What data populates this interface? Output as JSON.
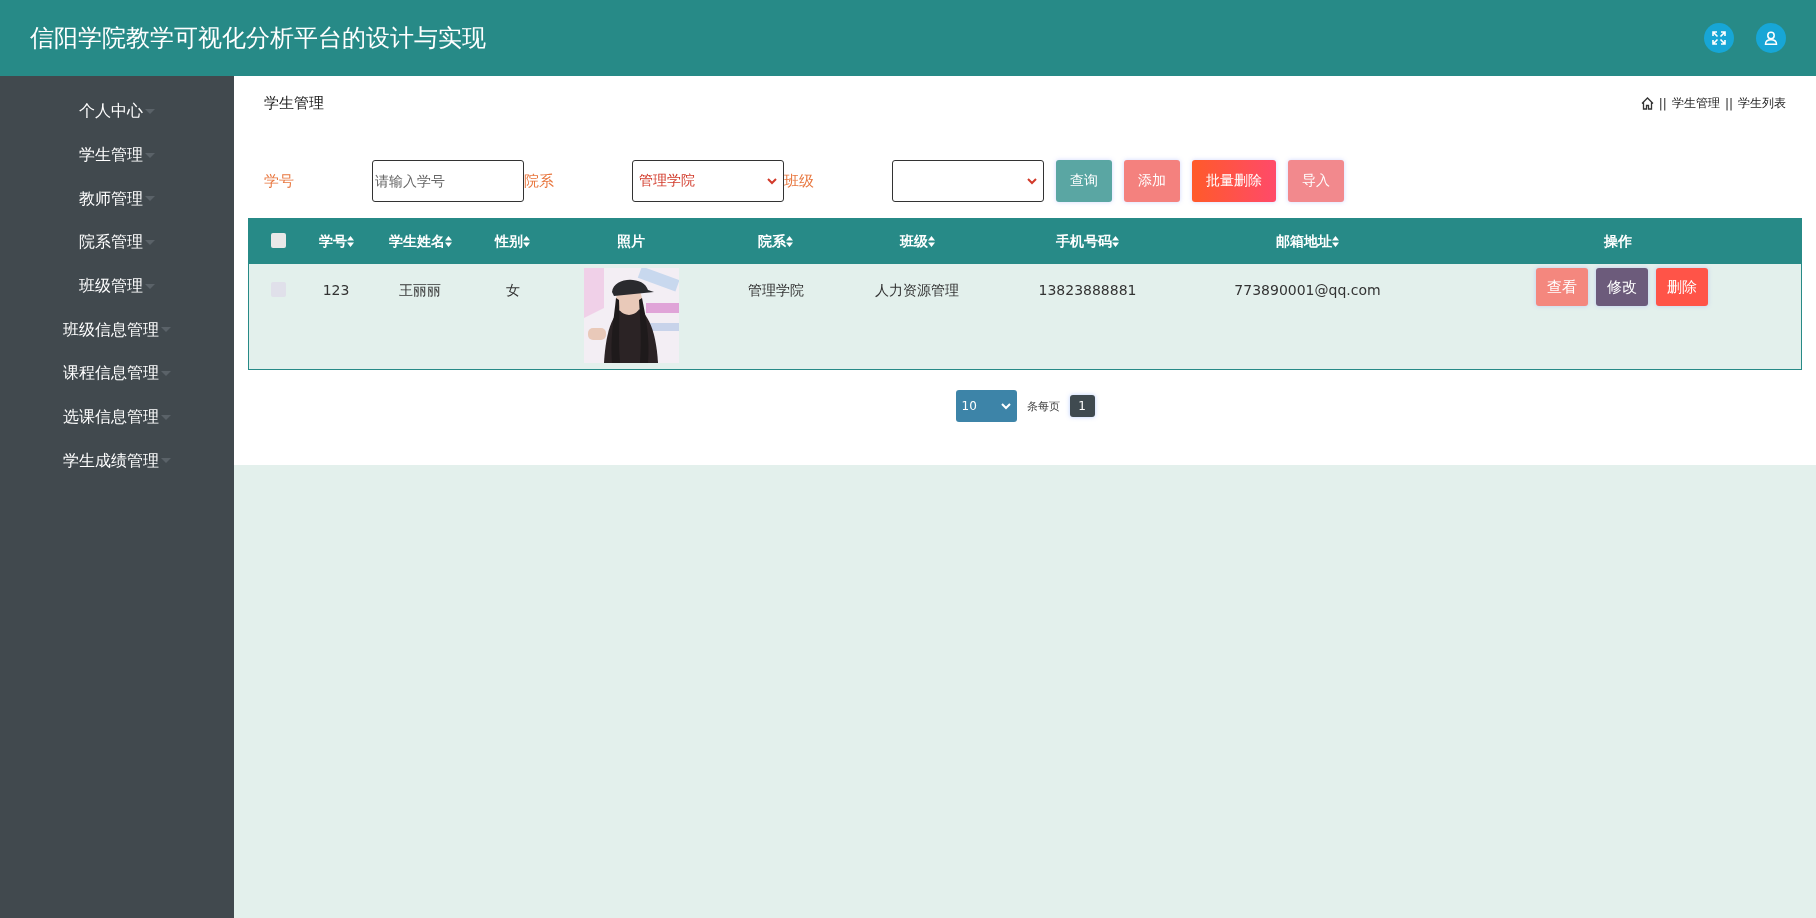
{
  "header": {
    "title": "信阳学院教学可视化分析平台的设计与实现"
  },
  "sidebar": {
    "items": [
      {
        "label": "个人中心"
      },
      {
        "label": "学生管理"
      },
      {
        "label": "教师管理"
      },
      {
        "label": "院系管理"
      },
      {
        "label": "班级管理"
      },
      {
        "label": "班级信息管理"
      },
      {
        "label": "课程信息管理"
      },
      {
        "label": "选课信息管理"
      },
      {
        "label": "学生成绩管理"
      }
    ]
  },
  "page_title": "学生管理",
  "breadcrumb": [
    {
      "separator": "||",
      "label": "学生管理"
    },
    {
      "separator": "||",
      "label": "学生列表"
    }
  ],
  "filters": [
    {
      "kind": "input",
      "label": "学号",
      "placeholder": "请输入学号"
    },
    {
      "kind": "select",
      "label": "院系",
      "value": "管理学院"
    },
    {
      "kind": "select",
      "label": "班级"
    }
  ],
  "actions": [
    {
      "kind": "search",
      "label": "查询"
    },
    {
      "kind": "add",
      "label": "添加"
    },
    {
      "kind": "bulk-delete",
      "label": "批量删除"
    },
    {
      "kind": "import",
      "label": "导入"
    }
  ],
  "table": {
    "all_checked": false,
    "columns": [
      {
        "label": "学号",
        "sortable": true
      },
      {
        "label": "学生姓名",
        "sortable": true
      },
      {
        "label": "性别",
        "sortable": true
      },
      {
        "label": "照片",
        "sortable": false
      },
      {
        "label": "院系",
        "sortable": true
      },
      {
        "label": "班级",
        "sortable": true
      },
      {
        "label": "手机号码",
        "sortable": true
      },
      {
        "label": "邮箱地址",
        "sortable": true
      },
      {
        "label": "操作",
        "sortable": false
      }
    ],
    "rows": [
      {
        "checked": false,
        "cells": [
          "123",
          "王丽丽",
          "女",
          {
            "kind": "picture"
          },
          "管理学院",
          "人力资源管理",
          "13823888881",
          "773890001@qq.com"
        ],
        "buttons": [
          {
            "kind": "view",
            "label": "查看"
          },
          {
            "kind": "edit",
            "label": "修改"
          },
          {
            "kind": "delete",
            "label": "删除"
          }
        ]
      }
    ]
  },
  "pagination": {
    "page_size": "10",
    "page_size_label": "条每页",
    "pages": [
      {
        "label": "1",
        "selected": true
      }
    ]
  }
}
